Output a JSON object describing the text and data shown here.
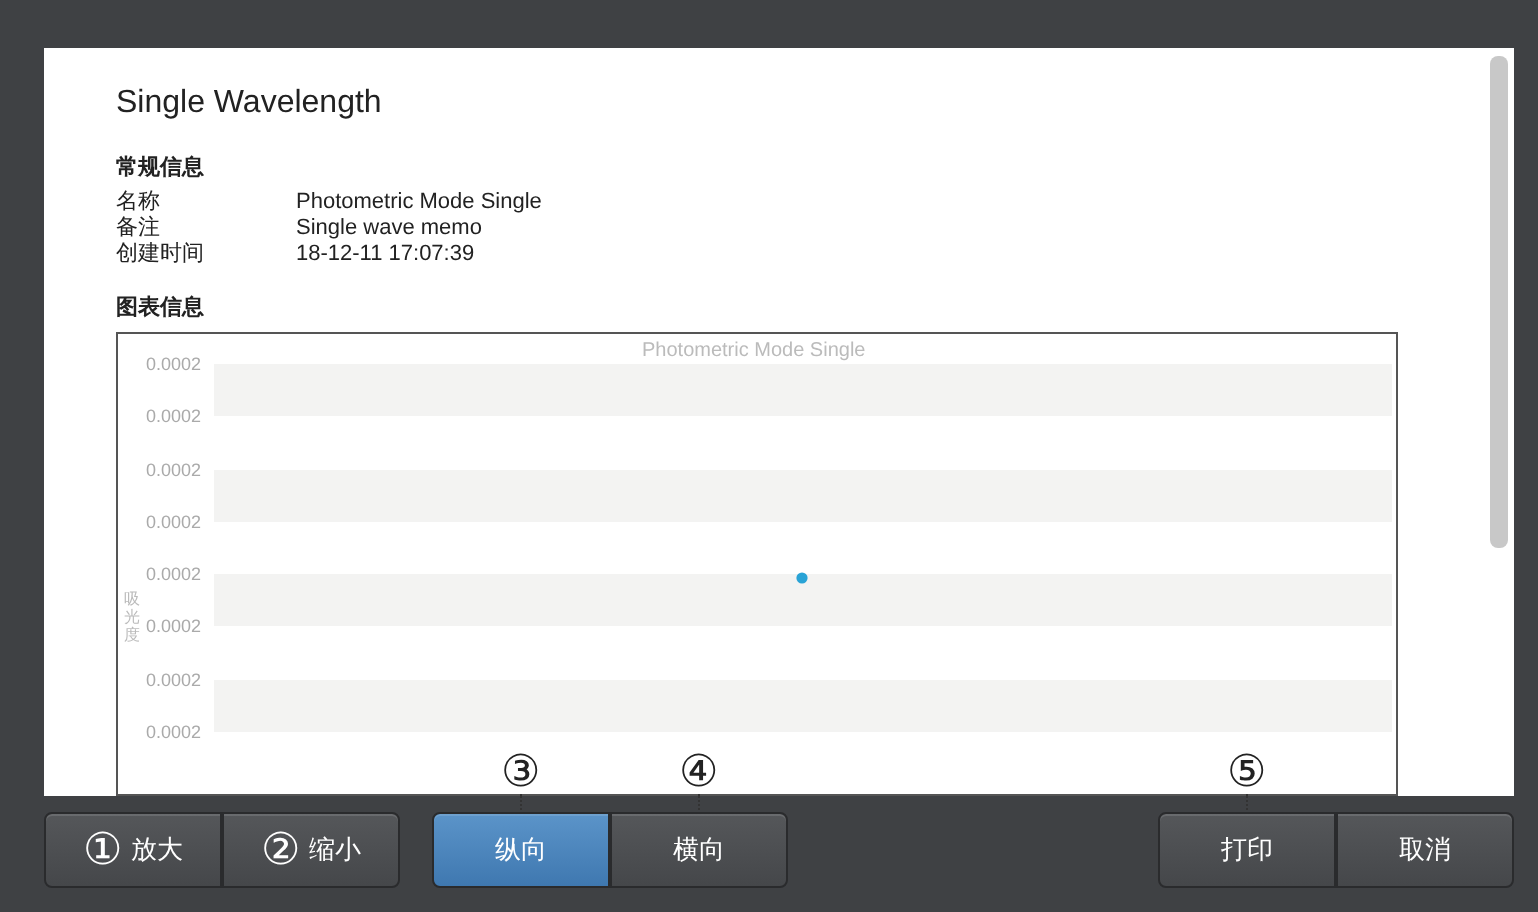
{
  "document": {
    "title": "Single Wavelength",
    "general_heading": "常规信息",
    "fields": [
      {
        "label": "名称",
        "value": "Photometric Mode Single"
      },
      {
        "label": "备注",
        "value": "Single wave memo"
      },
      {
        "label": "创建时间",
        "value": "18-12-11 17:07:39"
      }
    ],
    "chart_heading": "图表信息",
    "chart": {
      "title": "Photometric Mode Single",
      "ylabel": "吸光度",
      "ytick_labels": [
        "0.0002",
        "0.0002",
        "0.0002",
        "0.0002",
        "0.0002",
        "0.0002",
        "0.0002",
        "0.0002"
      ]
    }
  },
  "toolbar": {
    "groups": [
      {
        "buttons": [
          {
            "label": "放大",
            "selected": false,
            "callout": {
              "kind": "inline",
              "label": "①"
            }
          },
          {
            "label": "缩小",
            "selected": false,
            "callout": {
              "kind": "inline",
              "label": "②"
            }
          }
        ]
      },
      {
        "buttons": [
          {
            "label": "纵向",
            "selected": true,
            "callout": {
              "kind": "above",
              "label": "③"
            }
          },
          {
            "label": "横向",
            "selected": false,
            "callout": {
              "kind": "above",
              "label": "④"
            }
          }
        ]
      },
      {
        "buttons": [
          {
            "label": "打印",
            "selected": false,
            "callout": {
              "kind": "above",
              "label": "⑤"
            }
          },
          {
            "label": "取消",
            "selected": false
          }
        ]
      }
    ]
  }
}
